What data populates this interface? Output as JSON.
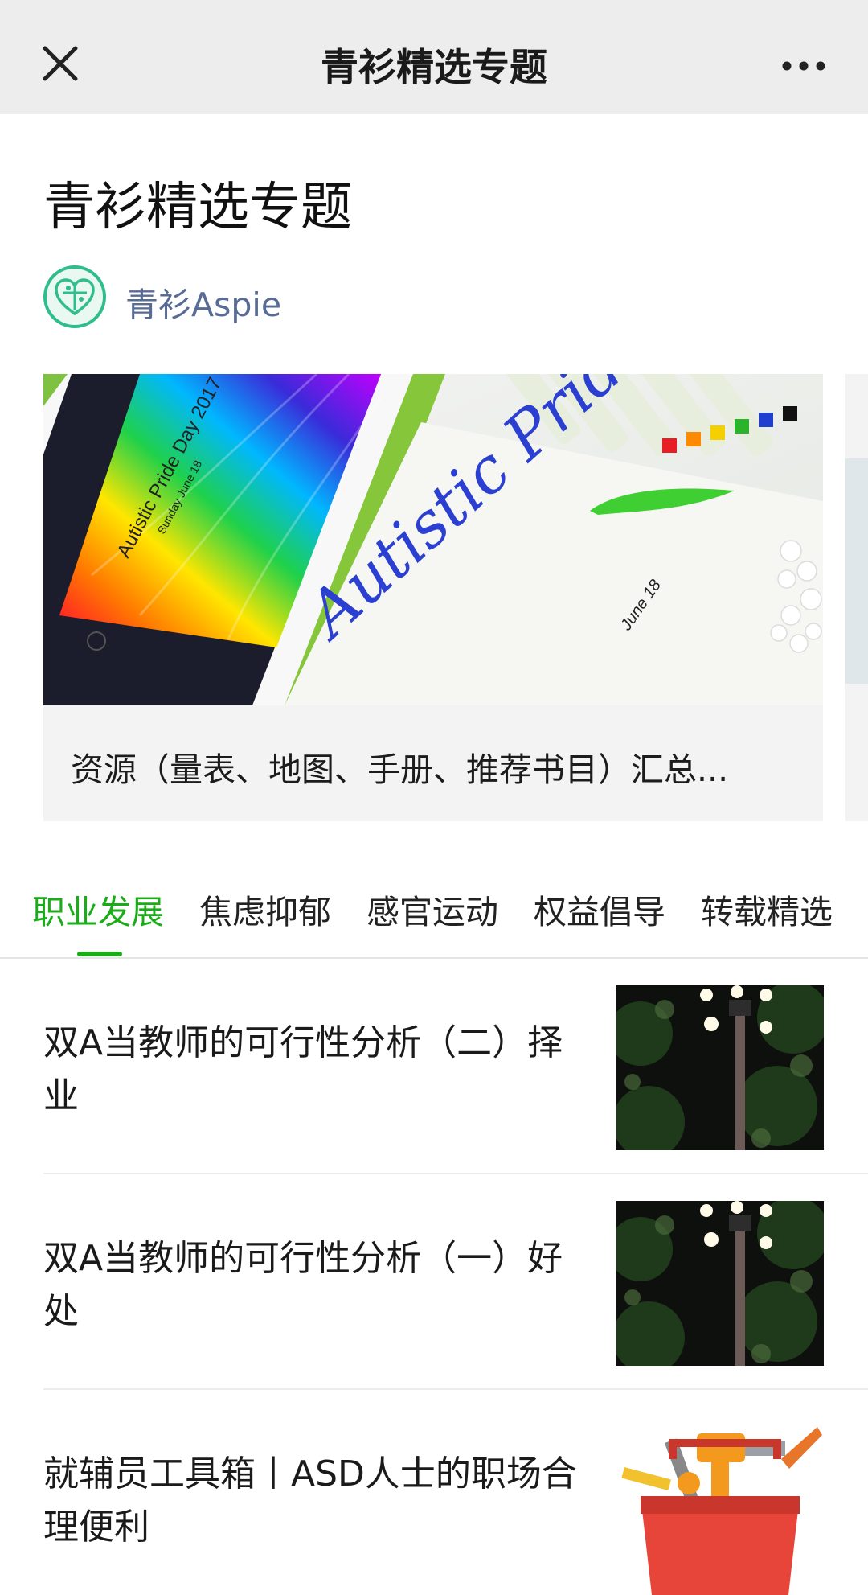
{
  "topbar": {
    "title": "青衫精选专题",
    "close_icon": "close-icon",
    "more_icon": "more-horizontal-icon"
  },
  "header": {
    "title": "青衫精选专题",
    "account": {
      "name": "青衫Aspie",
      "avatar_icon": "puzzle-heart-icon"
    }
  },
  "banner": {
    "caption": "资源（量表、地图、手册、推荐书目）汇总...",
    "image_text": {
      "tablet": "Autistic Pride Day 2017",
      "tablet_date": "Sunday June 18",
      "lettering": "Autistic Pride",
      "card_date": "June 18"
    }
  },
  "tabs": [
    {
      "label": "职业发展",
      "active": true
    },
    {
      "label": "焦虑抑郁",
      "active": false
    },
    {
      "label": "感官运动",
      "active": false
    },
    {
      "label": "权益倡导",
      "active": false
    },
    {
      "label": "转载精选",
      "active": false
    }
  ],
  "articles": [
    {
      "title": "双A当教师的可行性分析（二）择业",
      "thumb": "night-street-lamp"
    },
    {
      "title": "双A当教师的可行性分析（一）好处",
      "thumb": "night-street-lamp"
    },
    {
      "title": "就辅员工具箱丨ASD人士的职场合理便利",
      "thumb": "toolbox"
    }
  ],
  "colors": {
    "accent": "#1aad19",
    "account_link": "#576b95",
    "topbar_bg": "#ededed",
    "avatar_ring": "#2fbd8d"
  }
}
